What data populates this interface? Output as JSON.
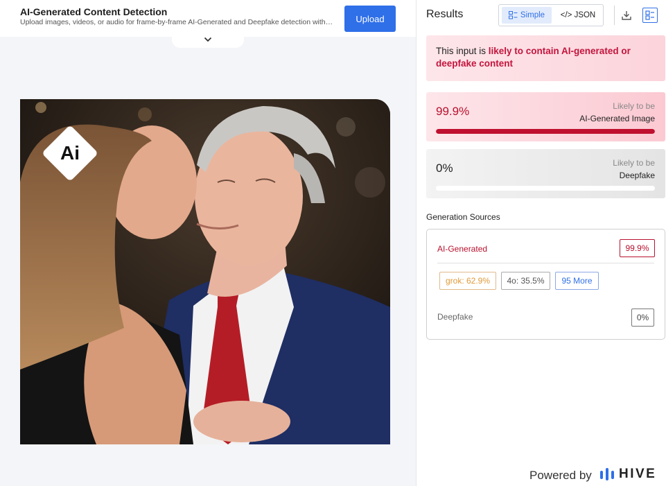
{
  "header": {
    "title": "AI-Generated Content Detection",
    "subtitle": "Upload images, videos, or audio for frame-by-frame AI-Generated and Deepfake detection with…",
    "upload_label": "Upload"
  },
  "badge": {
    "text": "Ai"
  },
  "results": {
    "title": "Results",
    "toggle": {
      "simple_label": "Simple",
      "json_label": "</> JSON",
      "active": "Simple"
    },
    "verdict": {
      "prefix": "This input is ",
      "highlight": "likely to contain AI-generated or deepfake content"
    },
    "scores": [
      {
        "value": "99.9%",
        "fraction": 0.999,
        "caption": "Likely to be",
        "label": "AI-Generated Image"
      },
      {
        "value": "0%",
        "fraction": 0.0,
        "caption": "Likely to be",
        "label": "Deepfake"
      }
    ],
    "generation_sources": {
      "title": "Generation Sources",
      "ai_label": "AI-Generated",
      "ai_value": "99.9%",
      "chips": [
        "grok: 62.9%",
        "4o: 35.5%",
        "95 More"
      ],
      "deepfake_label": "Deepfake",
      "deepfake_value": "0%"
    }
  },
  "footer": {
    "powered_by": "Powered by",
    "brand": "HIVE"
  },
  "colors": {
    "accent": "#2f6fe8",
    "alert": "#c3143c",
    "warning_chip": "#e09a3a"
  },
  "icons": [
    "chevron-down-icon",
    "simple-view-icon",
    "download-icon",
    "layout-icon",
    "hive-logo-icon",
    "ai-badge-icon"
  ]
}
